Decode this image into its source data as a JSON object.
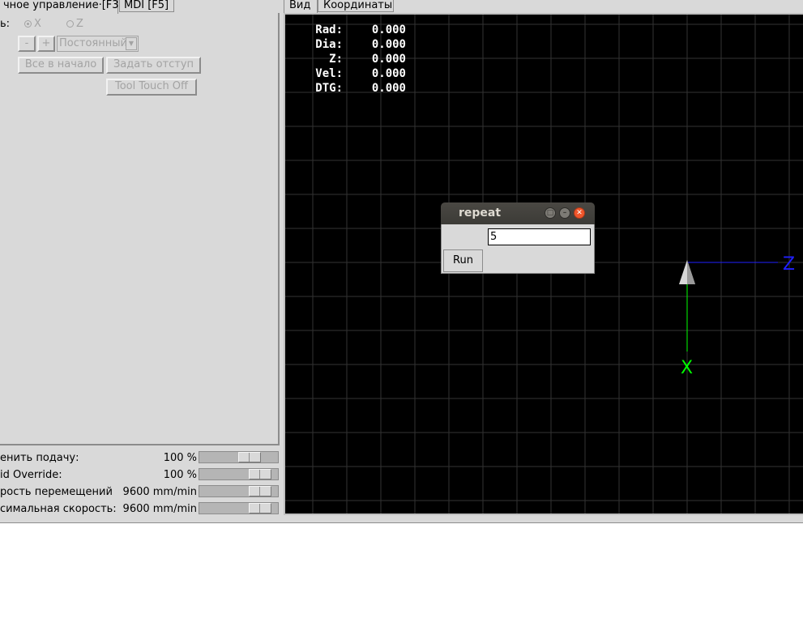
{
  "left_tabs": [
    {
      "label": "чное управление·[F3]"
    },
    {
      "label": "MDI [F5]"
    }
  ],
  "manual": {
    "axis_label": "ь:",
    "axis_options": [
      "X",
      "Z"
    ],
    "selected_axis": "X",
    "minus_label": "-",
    "plus_label": "+",
    "jog_mode": "Постоянный",
    "home_all_label": "Все в начало",
    "touch_off_label": "Задать отступ",
    "tool_touch_off_label": "Tool Touch Off"
  },
  "overrides": [
    {
      "label": "енить подачу:",
      "value": "100 %",
      "level": 0.7
    },
    {
      "label": "id Override:",
      "value": "100 %",
      "level": 0.88
    },
    {
      "label": "рость перемещений",
      "value": "9600 mm/min",
      "level": 0.88
    },
    {
      "label": "симальная скорость:",
      "value": "9600 mm/min",
      "level": 0.88
    }
  ],
  "right_tabs": [
    {
      "label": "Вид"
    },
    {
      "label": "Координаты"
    }
  ],
  "dro": [
    {
      "name": "Rad:",
      "value": "0.000"
    },
    {
      "name": "Dia:",
      "value": "0.000"
    },
    {
      "name": "Z:",
      "value": "0.000"
    },
    {
      "name": "Vel:",
      "value": "0.000"
    },
    {
      "name": "DTG:",
      "value": "0.000"
    }
  ],
  "axes": {
    "x_label": "X",
    "z_label": "Z",
    "x_color": "#00ff00",
    "z_color": "#2020ff"
  },
  "dialog": {
    "title": "repeat",
    "entry_value": "5",
    "run_label": "Run"
  },
  "colors": {
    "panel_bg": "#d9d9d9",
    "canvas_bg": "#000000",
    "grid": "#333333",
    "titlebar": "#3c3b37",
    "close_button": "#f0562b"
  }
}
